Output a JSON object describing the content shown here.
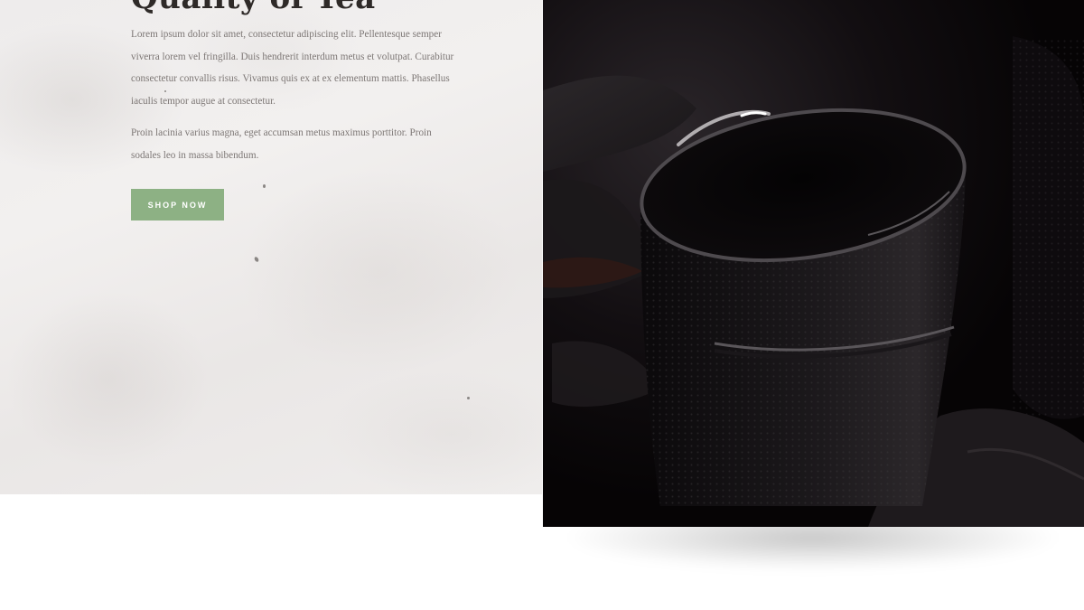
{
  "hero": {
    "heading": "Quality of Tea",
    "paragraph_1": "Lorem ipsum dolor sit amet, consectetur adipiscing elit. Pellentesque semper viverra lorem vel fringilla. Duis hendrerit interdum metus et volutpat. Curabitur consectetur convallis risus. Vivamus quis ex at ex elementum mattis. Phasellus iaculis tempor augue at consectetur.",
    "paragraph_2": "Proin lacinia varius magna, eget accumsan metus maximus porttitor. Proin sodales leo in massa bibendum.",
    "cta_label": "SHOP NOW"
  },
  "colors": {
    "accent": "#8db184",
    "heading": "#2e2a28",
    "body_text": "#7d7775",
    "photo_bg": "#0a0709"
  },
  "image": {
    "subject": "dark cast-iron tea cup",
    "icon": "photo"
  }
}
